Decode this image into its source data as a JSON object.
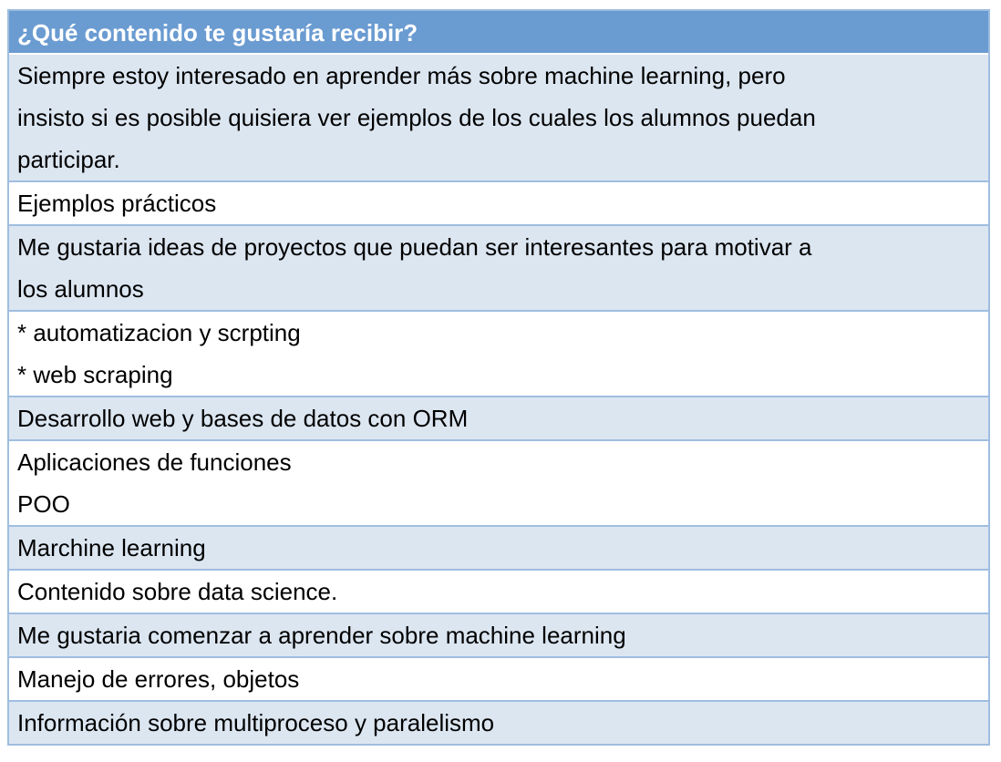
{
  "table": {
    "header": "¿Qué contenido te gustaría recibir?",
    "rows": [
      {
        "shaded": true,
        "lines": [
          "Siempre estoy interesado en aprender más sobre machine learning, pero",
          "insisto si es posible quisiera ver ejemplos de los cuales los alumnos puedan",
          "participar."
        ]
      },
      {
        "shaded": false,
        "lines": [
          "Ejemplos prácticos"
        ]
      },
      {
        "shaded": true,
        "lines": [
          "Me gustaria ideas de proyectos que puedan ser interesantes para motivar a",
          "los alumnos"
        ]
      },
      {
        "shaded": false,
        "lines": [
          "* automatizacion y  scrpting",
          "* web scraping"
        ]
      },
      {
        "shaded": true,
        "lines": [
          "Desarrollo web y bases de datos con ORM"
        ]
      },
      {
        "shaded": false,
        "lines": [
          "Aplicaciones de funciones",
          "POO"
        ]
      },
      {
        "shaded": true,
        "lines": [
          "Marchine learning"
        ]
      },
      {
        "shaded": false,
        "lines": [
          "Contenido sobre data science."
        ]
      },
      {
        "shaded": true,
        "lines": [
          "Me gustaria comenzar a aprender sobre machine learning"
        ]
      },
      {
        "shaded": false,
        "lines": [
          "Manejo de errores, objetos"
        ]
      },
      {
        "shaded": true,
        "lines": [
          "Información sobre multiproceso y paralelismo"
        ]
      }
    ]
  }
}
